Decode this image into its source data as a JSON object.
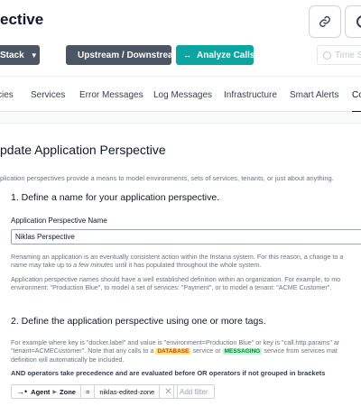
{
  "header": {
    "title": "ective",
    "link_icon": "link-icon",
    "partial_icon": "partial-circle-icon"
  },
  "toolbar": {
    "stack_label": "Stack",
    "upstream_label": "Upstream / Downstream",
    "analyze_label": "Analyze Calls",
    "time_placeholder": "Time S"
  },
  "tabs": [
    {
      "label": "cies"
    },
    {
      "label": "Services"
    },
    {
      "label": "Error Messages"
    },
    {
      "label": "Log Messages"
    },
    {
      "label": "Infrastructure"
    },
    {
      "label": "Smart Alerts"
    },
    {
      "label": "Co"
    }
  ],
  "form": {
    "heading": "pdate Application Perspective",
    "intro": "plication perspectives provide a means to model environments, sets of services, tenants, or just about anything.",
    "step1": "1. Define a name for your application perspective.",
    "name_label": "Application Perspective Name",
    "name_value": "Niklas Perspective",
    "help1_a": "Renaming an application is an eventually consistent action within the Instana system. For this reason, a change to a",
    "help1_b_pre": "name may take up to ",
    "help1_b_em": "a few minutes",
    "help1_b_post": " until it has populated throughout the whole system.",
    "help2_a": "Application perspective names should have a well established definition within an organization. For example, to mo",
    "help2_b": "environment: \"Production Blue\", to model a set of services: \"Payment\", or to model a tenant: \"ACME Customer\".",
    "step2": "2. Define the application perspective using one or more tags.",
    "ex_a": "For example where key is \"docker.label\" and value is \"environment=Production Blue\" or key is \"call.http.params\" ar",
    "ex_b_pre": "\"tenant=ACMECustomer\". Note that any calls to a ",
    "ex_db": "DATABASE",
    "ex_b_mid": " service or ",
    "ex_msg": "MESSAGING",
    "ex_b_post": " service from services mat",
    "ex_c": "definition will automatically be included.",
    "and_note": "AND operators take precedence and are evaluated before OR operators if not grouped in brackets",
    "filter": {
      "key_a": "Agent",
      "key_b": "Zone",
      "op": "=",
      "value": "niklas-edited-zone",
      "add_label": "Add filter"
    }
  }
}
